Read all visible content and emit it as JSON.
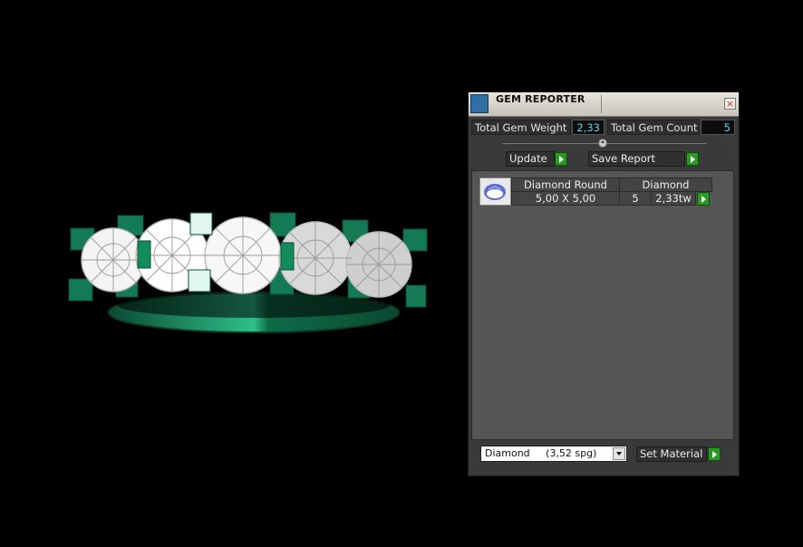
{
  "panel": {
    "title": "GEM REPORTER",
    "total_weight_label": "Total Gem Weight",
    "total_weight_value": "2,33",
    "total_count_label": "Total Gem Count",
    "total_count_value": "5",
    "update_label": "Update",
    "save_report_label": "Save Report",
    "gem_rows": [
      {
        "name": "Diamond Round",
        "material": "Diamond",
        "size": "5,00 X 5,00",
        "count": "5",
        "weight": "2,33tw"
      }
    ],
    "material_select": "Diamond     (3,52 spg)",
    "set_material_label": "Set Material"
  },
  "colors": {
    "metal": "#137a55",
    "gem": "#ffffff",
    "value_text": "#5fd3f0",
    "play_button": "#2a9a25"
  },
  "icons": [
    "gem-reporter-icon",
    "close-icon",
    "slider-knob",
    "play-icon",
    "gem-thumbnail-icon",
    "dropdown-arrow-icon"
  ]
}
